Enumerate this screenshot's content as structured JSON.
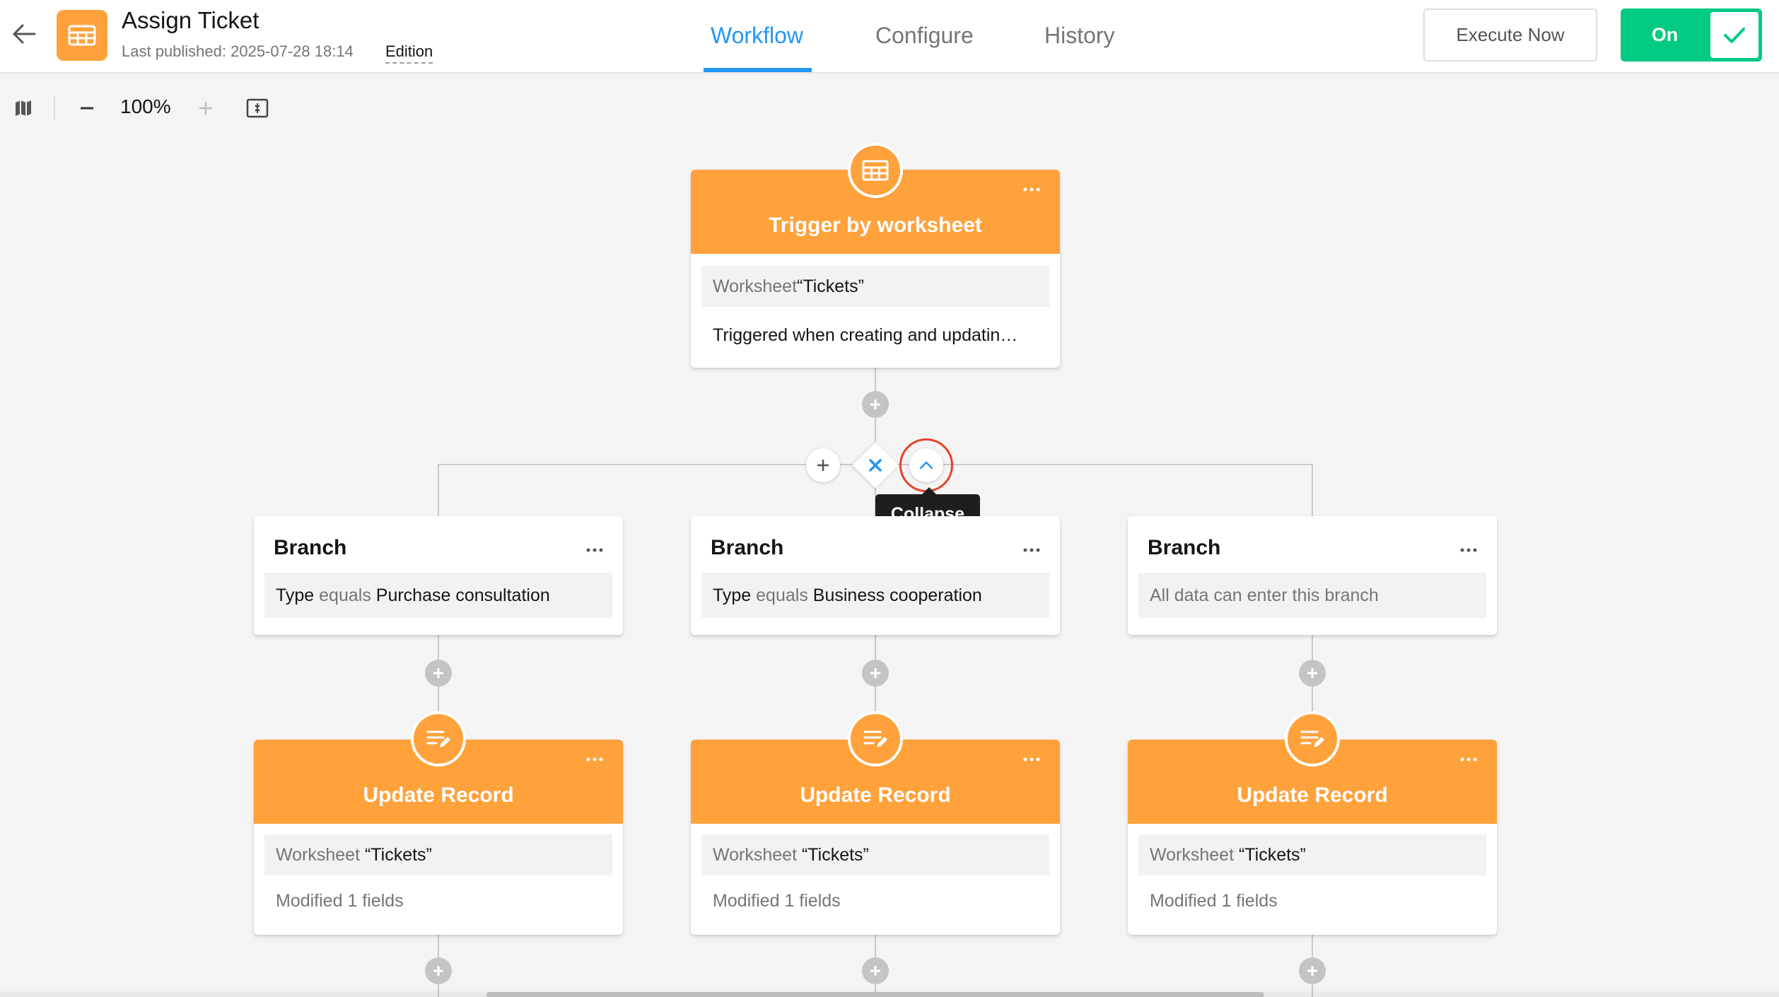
{
  "header": {
    "title": "Assign Ticket",
    "last_published": "Last published: 2025-07-28 18:14",
    "edition_label": "Edition",
    "tabs": [
      {
        "label": "Workflow",
        "active": true
      },
      {
        "label": "Configure",
        "active": false
      },
      {
        "label": "History",
        "active": false
      }
    ],
    "execute_label": "Execute Now",
    "toggle_label": "On",
    "toggle_on": true,
    "accent_color": "#2196f3",
    "brand_color": "#ffa23b",
    "toggle_color": "#01ca83"
  },
  "toolbar": {
    "zoom": "100%",
    "icons": [
      "map-icon",
      "zoom-out-icon",
      "zoom-in-icon",
      "fit-screen-icon"
    ]
  },
  "trigger": {
    "title": "Trigger by worksheet",
    "icon": "table-icon",
    "worksheet_key": "Worksheet",
    "worksheet_value": "“Tickets”",
    "description": "Triggered when creating and updatin…"
  },
  "branch_controls": {
    "tooltip": "Collapse",
    "icons": [
      "plus-icon",
      "close-icon",
      "chevron-up-icon"
    ]
  },
  "branches": [
    {
      "title": "Branch",
      "field": "Type",
      "operator": "equals",
      "value": "Purchase consultation"
    },
    {
      "title": "Branch",
      "field": "Type",
      "operator": "equals",
      "value": "Business cooperation"
    },
    {
      "title": "Branch",
      "note": "All data can enter this branch"
    }
  ],
  "actions": [
    {
      "title": "Update Record",
      "icon": "edit-list-icon",
      "worksheet_key": "Worksheet",
      "worksheet_value": "“Tickets”",
      "summary": "Modified 1 fields"
    },
    {
      "title": "Update Record",
      "icon": "edit-list-icon",
      "worksheet_key": "Worksheet",
      "worksheet_value": "“Tickets”",
      "summary": "Modified 1 fields"
    },
    {
      "title": "Update Record",
      "icon": "edit-list-icon",
      "worksheet_key": "Worksheet",
      "worksheet_value": "“Tickets”",
      "summary": "Modified 1 fields"
    }
  ]
}
